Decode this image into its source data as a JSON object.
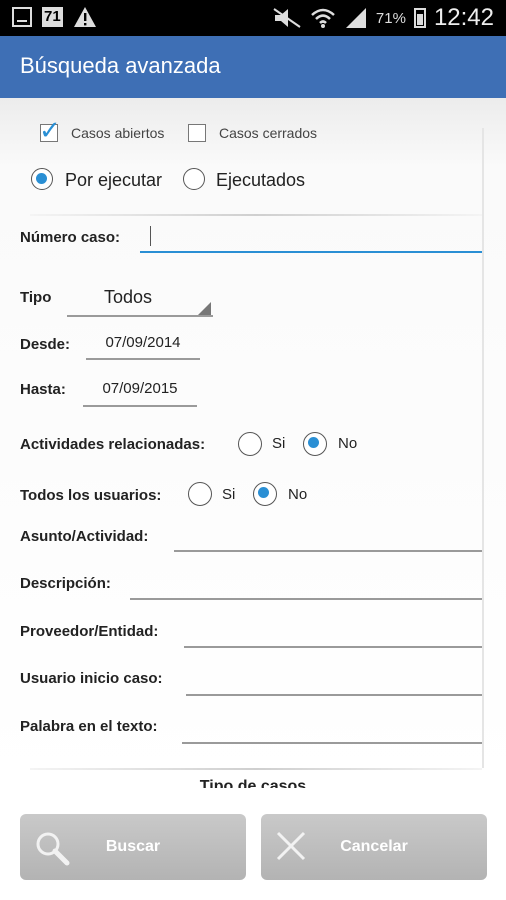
{
  "status_bar": {
    "left_number": "71",
    "battery_percent": "71%",
    "time": "12:42"
  },
  "appbar": {
    "title": "Búsqueda avanzada"
  },
  "filters": {
    "open_cases_label": "Casos abiertos",
    "open_cases_checked": true,
    "closed_cases_label": "Casos cerrados",
    "closed_cases_checked": false,
    "pending_label": "Por ejecutar",
    "executed_label": "Ejecutados",
    "selected_status": "Por ejecutar"
  },
  "form": {
    "case_number_label": "Número caso:",
    "case_number_value": "",
    "type_label": "Tipo",
    "type_value": "Todos",
    "from_label": "Desde:",
    "from_value": "07/09/2014",
    "to_label": "Hasta:",
    "to_value": "07/09/2015",
    "related_activities_label": "Actividades relacionadas:",
    "related_yes": "Si",
    "related_no": "No",
    "related_selected": "No",
    "all_users_label": "Todos los usuarios:",
    "users_yes": "Si",
    "users_no": "No",
    "users_selected": "No",
    "subject_label": "Asunto/Actividad:",
    "description_label": "Descripción:",
    "provider_label": "Proveedor/Entidad:",
    "user_start_label": "Usuario inicio caso:",
    "text_word_label": "Palabra en el texto:",
    "section_cut_label": "Tipo de casos"
  },
  "buttons": {
    "search_label": "Buscar",
    "cancel_label": "Cancelar"
  },
  "colors": {
    "appbar": "#3e6fb5",
    "accent": "#2a8fd4",
    "button": "#bdbdbd"
  }
}
